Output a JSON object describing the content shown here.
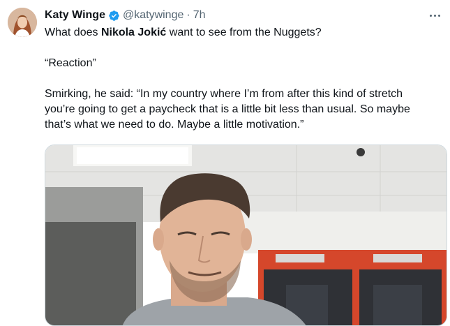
{
  "tweet": {
    "author_name": "Katy Winge",
    "handle": "@katywinge",
    "separator": "·",
    "time": "7h",
    "text_prefix": "What does ",
    "text_bold": "Nikola Jokić",
    "text_suffix": " want to see from the Nuggets?",
    "line2": "“Reaction”",
    "line3": "Smirking, he said: “In my country where I’m from after this kind of stretch",
    "line4": "you’re going to get a paycheck that is a little bit less than usual. So maybe",
    "line5": "that’s what we need to do. Maybe a little motivation.”"
  },
  "colors": {
    "verified_badge": "#1d9bf0",
    "secondary_text": "#536471",
    "locker_red": "#d5472b"
  },
  "icons": {
    "verified": "verified-badge-icon",
    "more": "more-options-icon"
  }
}
